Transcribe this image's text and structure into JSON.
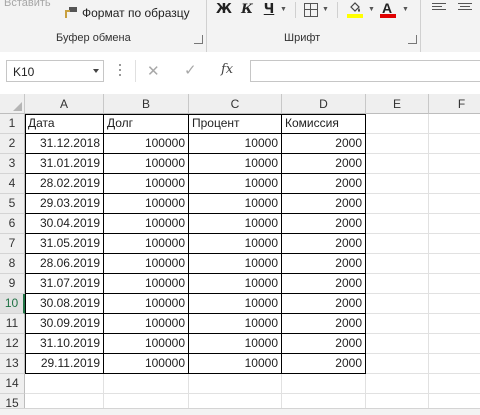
{
  "ribbon": {
    "insert_label": "Вставить",
    "format_painter_label": "Формат по образцу",
    "clipboard_group": "Буфер обмена",
    "font_group": "Шрифт",
    "bold_label": "Ж",
    "italic_label": "К",
    "underline_label": "Ч",
    "font_color_letter": "A",
    "fill_color": "#ffff00",
    "font_color": "#e00000"
  },
  "formula_bar": {
    "name_box": "K10",
    "cancel_icon": "✕",
    "enter_icon": "✓",
    "fx_label": "fx",
    "formula": ""
  },
  "sheet": {
    "columns": [
      "A",
      "B",
      "C",
      "D",
      "E",
      "F"
    ],
    "active_row": 10,
    "row_numbers": [
      "1",
      "2",
      "3",
      "4",
      "5",
      "6",
      "7",
      "8",
      "9",
      "10",
      "11",
      "12",
      "13",
      "14",
      "15"
    ],
    "header": [
      "Дата",
      "Долг",
      "Процент",
      "Комиссия"
    ],
    "rows": [
      [
        "31.12.2018",
        "100000",
        "10000",
        "2000"
      ],
      [
        "31.01.2019",
        "100000",
        "10000",
        "2000"
      ],
      [
        "28.02.2019",
        "100000",
        "10000",
        "2000"
      ],
      [
        "29.03.2019",
        "100000",
        "10000",
        "2000"
      ],
      [
        "30.04.2019",
        "100000",
        "10000",
        "2000"
      ],
      [
        "31.05.2019",
        "100000",
        "10000",
        "2000"
      ],
      [
        "28.06.2019",
        "100000",
        "10000",
        "2000"
      ],
      [
        "31.07.2019",
        "100000",
        "10000",
        "2000"
      ],
      [
        "30.08.2019",
        "100000",
        "10000",
        "2000"
      ],
      [
        "30.09.2019",
        "100000",
        "10000",
        "2000"
      ],
      [
        "31.10.2019",
        "100000",
        "10000",
        "2000"
      ],
      [
        "29.11.2019",
        "100000",
        "10000",
        "2000"
      ]
    ]
  }
}
